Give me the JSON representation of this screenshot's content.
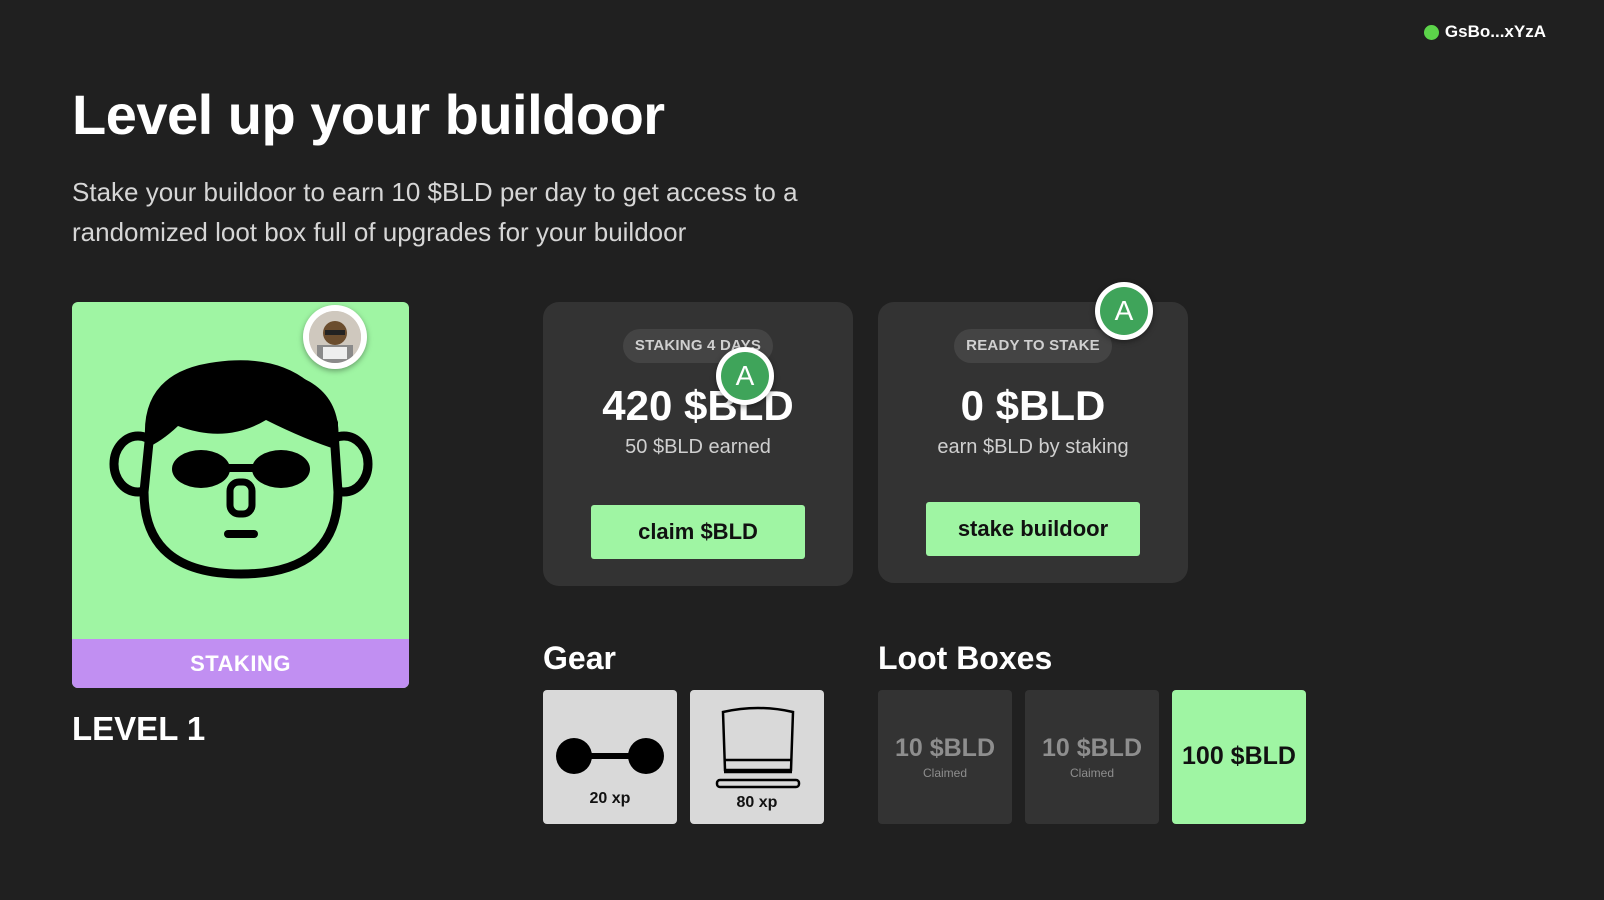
{
  "wallet": {
    "address": "GsBo...xYzA",
    "status_color": "#5cd44a"
  },
  "header": {
    "title": "Level up your buildoor",
    "subtitle": "Stake your buildoor to earn 10 $BLD per day to get access to a randomized loot box full of upgrades for your buildoor"
  },
  "character": {
    "status_label": "STAKING",
    "level_label": "LEVEL 1",
    "avatar_icon": "buildoor-avatar-icon"
  },
  "staking_card": {
    "pill": "STAKING 4 DAYS",
    "amount": "420 $BLD",
    "note": "50 $BLD earned",
    "button_label": "claim $BLD",
    "badge_letter": "A"
  },
  "stake_card": {
    "pill": "READY TO STAKE",
    "amount": "0 $BLD",
    "note": "earn $BLD by staking",
    "button_label": "stake buildoor",
    "badge_letter": "A"
  },
  "gear": {
    "title": "Gear",
    "items": [
      {
        "icon": "glasses-icon",
        "xp": "20 xp"
      },
      {
        "icon": "top-hat-icon",
        "xp": "80 xp"
      }
    ]
  },
  "loot_boxes": {
    "title": "Loot Boxes",
    "items": [
      {
        "price": "10 $BLD",
        "status": "Claimed"
      },
      {
        "price": "10 $BLD",
        "status": "Claimed"
      },
      {
        "price": "100 $BLD",
        "status": ""
      }
    ]
  },
  "colors": {
    "accent_green": "#9ff5a3",
    "staking_purple": "#c18ff2",
    "background": "#202020",
    "card": "#333333"
  }
}
